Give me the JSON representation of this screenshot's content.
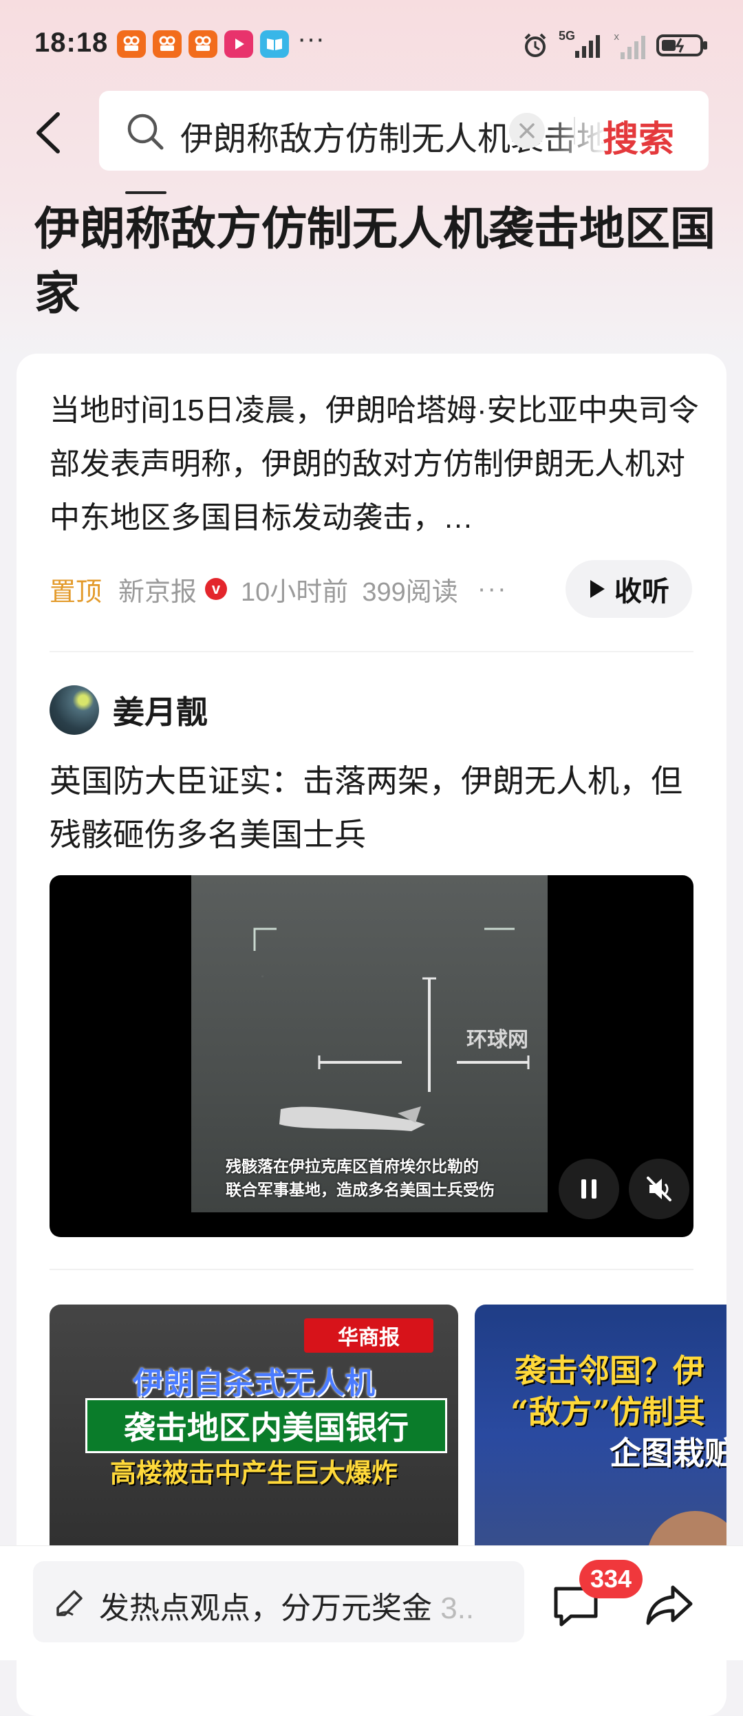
{
  "status_bar": {
    "time": "18:18",
    "more": "···",
    "network": "5G"
  },
  "search": {
    "query": "伊朗称敌方仿制无人机袭击地区国家",
    "button": "搜索"
  },
  "topic": {
    "title": "伊朗称敌方仿制无人机袭击地区国家"
  },
  "card": {
    "summary": "当地时间15日凌晨，伊朗哈塔姆·安比亚中央司令部发表声明称，伊朗的敌对方仿制伊朗无人机对中东地区多国目标发动袭击，…",
    "meta": {
      "pinned": "置顶",
      "source": "新京报",
      "verified": "v",
      "time": "10小时前",
      "reads": "399阅读",
      "more": "···"
    },
    "listen_label": "收听"
  },
  "post": {
    "author": "姜月靓",
    "text": "英国防大臣证实：击落两架，伊朗无人机，但残骸砸伤多名美国士兵",
    "video": {
      "watermark": "环球网",
      "caption_line1": "残骸落在伊拉克库区首府埃尔比勒的",
      "caption_line2": "联合军事基地，造成多名美国士兵受伤"
    }
  },
  "thumbnails": [
    {
      "logo": "华商报",
      "line1": "伊朗自杀式无人机",
      "line2": "袭击地区内美国银行",
      "line3": "高楼被击中产生巨大爆炸"
    },
    {
      "line1": "袭击邻国？伊",
      "line2": "“敌方”仿制其",
      "line3": "企图栽赃"
    }
  ],
  "bottom_bar": {
    "comment_placeholder": "发热点观点，分万元奖金",
    "comment_suffix": "3..",
    "comment_count": "334"
  }
}
